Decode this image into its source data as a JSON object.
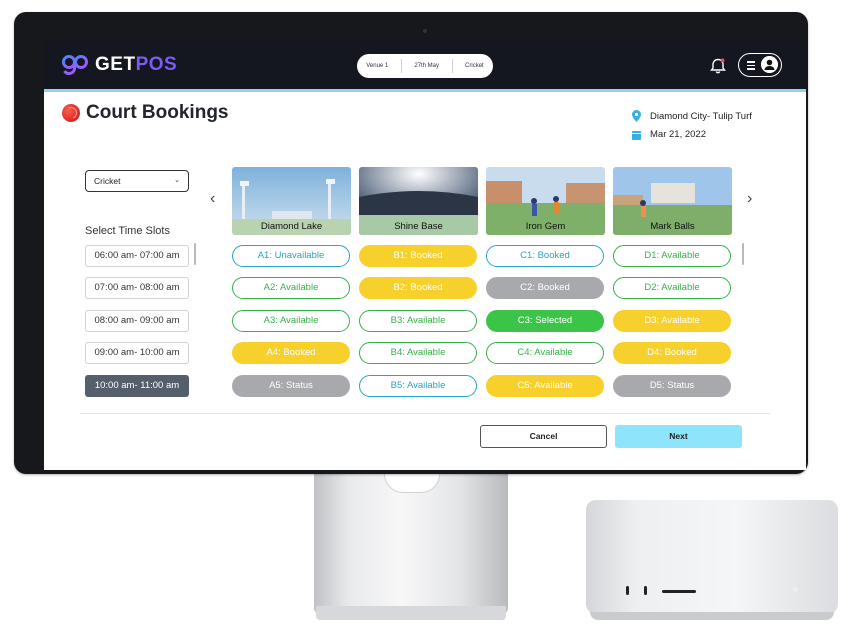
{
  "app": {
    "logo_text_main": "GET",
    "logo_text_accent": "POS",
    "filters": [
      "Venue 1",
      "27th May",
      "Cricket"
    ]
  },
  "page": {
    "title": "Court Bookings",
    "venue": "Diamond City- Tulip Turf",
    "date": "Mar 21, 2022"
  },
  "sport_select": {
    "value": "Cricket"
  },
  "time_slots": {
    "title": "Select Time Slots",
    "items": [
      "06:00 am- 07:00 am",
      "07:00 am- 08:00 am",
      "08:00 am- 09:00 am",
      "09:00 am- 10:00 am",
      "10:00 am- 11:00 am"
    ],
    "active_index": 4
  },
  "courts": [
    {
      "name": "Diamond Lake",
      "slots": [
        {
          "label": "A1: Unavailable",
          "state": "unavailable"
        },
        {
          "label": "A2: Available",
          "state": "available"
        },
        {
          "label": "A3: Available",
          "state": "available"
        },
        {
          "label": "A4: Booked",
          "state": "booked-yellow"
        },
        {
          "label": "A5: Status",
          "state": "booked-grey"
        }
      ]
    },
    {
      "name": "Shine Base",
      "slots": [
        {
          "label": "B1: Booked",
          "state": "booked-yellow"
        },
        {
          "label": "B2: Booked",
          "state": "booked-yellow"
        },
        {
          "label": "B3: Available",
          "state": "available"
        },
        {
          "label": "B4: Available",
          "state": "available"
        },
        {
          "label": "B5: Available",
          "state": "outline-blue"
        }
      ]
    },
    {
      "name": "Iron Gem",
      "slots": [
        {
          "label": "C1: Booked",
          "state": "outline-blue"
        },
        {
          "label": "C2: Booked",
          "state": "booked-grey"
        },
        {
          "label": "C3: Selected",
          "state": "selected"
        },
        {
          "label": "C4: Available",
          "state": "available"
        },
        {
          "label": "C5: Available",
          "state": "booked-yellow"
        }
      ]
    },
    {
      "name": "Mark Balls",
      "slots": [
        {
          "label": "D1: Available",
          "state": "available"
        },
        {
          "label": "D2: Available",
          "state": "available"
        },
        {
          "label": "D3: Available",
          "state": "booked-yellow"
        },
        {
          "label": "D4: Booked",
          "state": "booked-yellow"
        },
        {
          "label": "D5: Status",
          "state": "booked-grey"
        }
      ]
    }
  ],
  "actions": {
    "cancel": "Cancel",
    "next": "Next"
  },
  "colors": {
    "topbar": "#14171f",
    "accent_purple": "#7a5cf0",
    "next_button": "#8ee4fb",
    "available": "#36b24a",
    "booked": "#f7d02c",
    "status_grey": "#a7a9ad",
    "selected": "#3bc447"
  }
}
